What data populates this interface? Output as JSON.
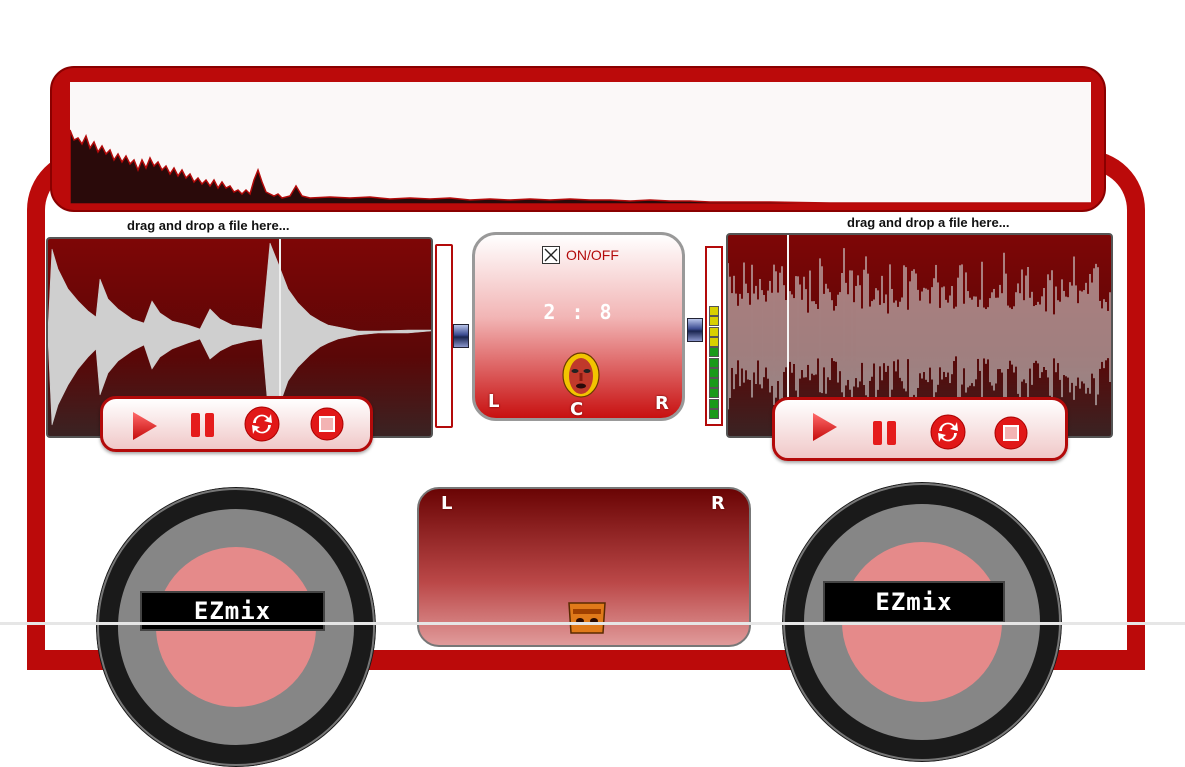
{
  "top_waveform": {
    "label": "master waveform"
  },
  "deck_left": {
    "drop_label": "drag and drop a file here...",
    "controls": {
      "play": "play-icon",
      "pause": "pause-icon",
      "loop": "loop-icon",
      "stop": "stop-icon"
    },
    "turntable_label": "EZmix"
  },
  "deck_right": {
    "drop_label": "drag and drop a file here...",
    "controls": {
      "play": "play-icon",
      "pause": "pause-icon",
      "loop": "loop-icon",
      "stop": "stop-icon"
    },
    "turntable_label": "EZmix"
  },
  "center": {
    "onoff_label": "ON/OFF",
    "onoff_checked": true,
    "ratio": "2 : 8",
    "pan_left": "L",
    "pan_center": "C",
    "pan_right": "R"
  },
  "pan_panel": {
    "left": "L",
    "right": "R"
  },
  "vu_meter": {
    "level_segments": 11,
    "total_segments": 11
  },
  "colors": {
    "accent": "#bb0a0a",
    "dark_red": "#7e0606",
    "vu_green": "#1a9a1a",
    "vu_yellow": "#d8d000"
  }
}
